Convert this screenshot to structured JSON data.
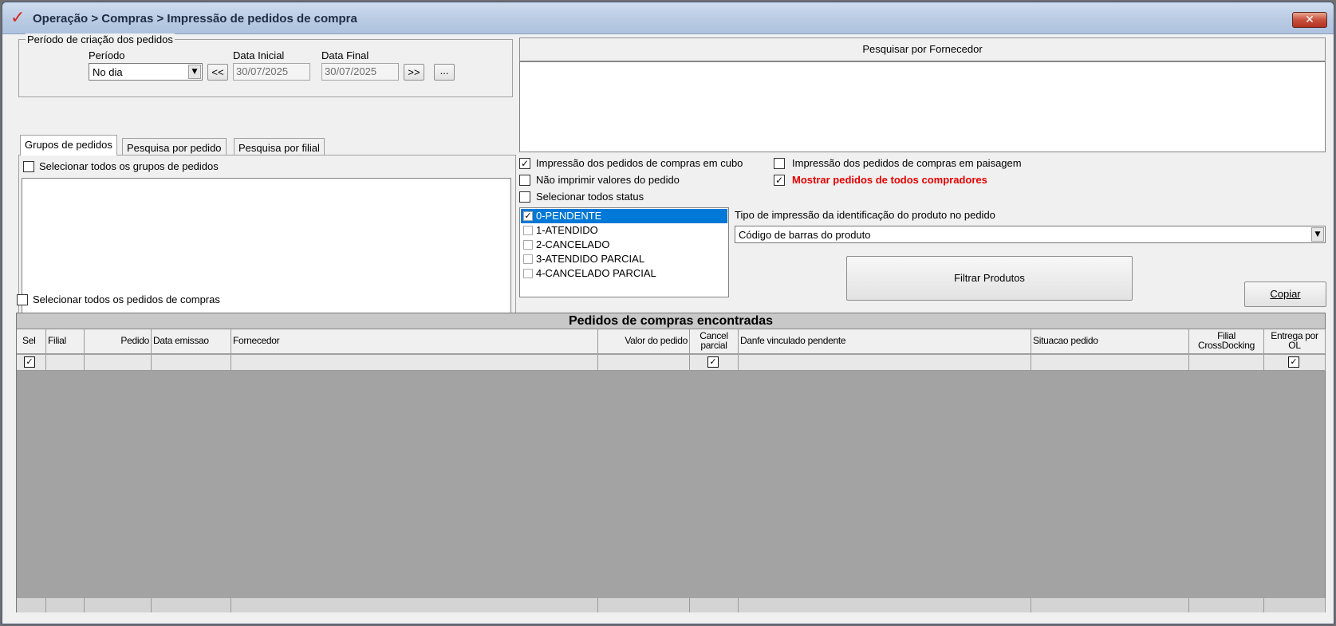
{
  "window": {
    "title": "Operação > Compras > Impressão de pedidos de compra",
    "close_glyph": "✕"
  },
  "periodo_group": {
    "legend": "Período de criação dos pedidos",
    "periodo_label": "Período",
    "periodo_value": "No dia",
    "data_inicial_label": "Data Inicial",
    "data_inicial_value": "30/07/2025",
    "data_final_label": "Data Final",
    "data_final_value": "30/07/2025",
    "prev_btn": "<<",
    "next_btn": ">>",
    "more_btn": "..."
  },
  "tabs": [
    {
      "label": "Grupos de pedidos",
      "active": true
    },
    {
      "label": "Pesquisa por pedido",
      "active": false
    },
    {
      "label": "Pesquisa por filial",
      "active": false
    }
  ],
  "grupos": {
    "select_all_label": "Selecionar todos os grupos de pedidos",
    "select_all_checked": false
  },
  "select_all_pedidos_label": "Selecionar todos os pedidos de compras",
  "fornecedor": {
    "button_label": "Pesquisar por Fornecedor"
  },
  "options": {
    "cubo_label": "Impressão dos pedidos de compras em cubo",
    "cubo_checked": true,
    "paisagem_label": "Impressão dos pedidos de compras em paisagem",
    "paisagem_checked": false,
    "nao_imprimir_label": "Não imprimir valores do pedido",
    "nao_imprimir_checked": false,
    "todos_compradores_label": "Mostrar pedidos de todos compradores",
    "todos_compradores_checked": true,
    "todos_compradores_color": "#e60000",
    "selecionar_status_label": "Selecionar todos status",
    "selecionar_status_checked": false
  },
  "status_list": [
    {
      "label": "0-PENDENTE",
      "checked": true,
      "selected": true
    },
    {
      "label": "1-ATENDIDO",
      "checked": false,
      "selected": false
    },
    {
      "label": "2-CANCELADO",
      "checked": false,
      "selected": false
    },
    {
      "label": "3-ATENDIDO PARCIAL",
      "checked": false,
      "selected": false
    },
    {
      "label": "4-CANCELADO PARCIAL",
      "checked": false,
      "selected": false
    }
  ],
  "tipo_impressao": {
    "label": "Tipo de impressão da identificação do produto no pedido",
    "value": "Código de barras do produto"
  },
  "filtrar_btn": "Filtrar Produtos",
  "copiar_btn": "Copiar",
  "grid": {
    "caption": "Pedidos de compras encontradas",
    "columns": [
      {
        "label": "Sel"
      },
      {
        "label": "Filial"
      },
      {
        "label": "Pedido"
      },
      {
        "label": "Data emissao"
      },
      {
        "label": "Fornecedor"
      },
      {
        "label": "Valor do pedido"
      },
      {
        "label": "Cancel parcial"
      },
      {
        "label": "Danfe vinculado pendente"
      },
      {
        "label": "Situacao pedido"
      },
      {
        "label": "Filial CrossDocking"
      },
      {
        "label": "Entrega por OL"
      }
    ],
    "row_checks": {
      "sel": true,
      "cancel_parcial": true,
      "entrega_ol": true
    }
  }
}
